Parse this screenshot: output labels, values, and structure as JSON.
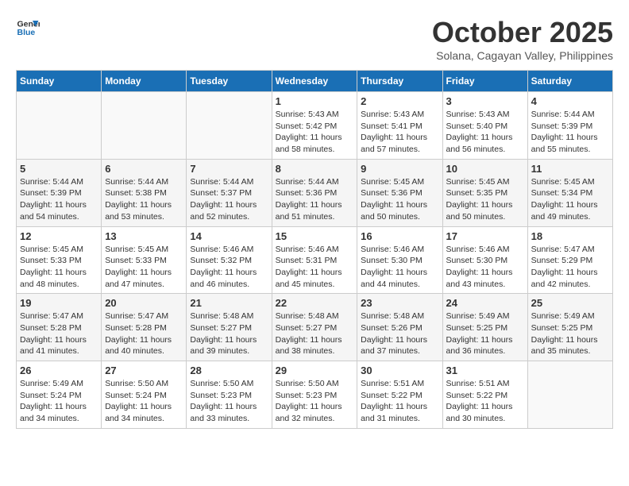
{
  "header": {
    "logo_line1": "General",
    "logo_line2": "Blue",
    "month": "October 2025",
    "location": "Solana, Cagayan Valley, Philippines"
  },
  "weekdays": [
    "Sunday",
    "Monday",
    "Tuesday",
    "Wednesday",
    "Thursday",
    "Friday",
    "Saturday"
  ],
  "weeks": [
    [
      {
        "day": "",
        "sunrise": "",
        "sunset": "",
        "daylight": ""
      },
      {
        "day": "",
        "sunrise": "",
        "sunset": "",
        "daylight": ""
      },
      {
        "day": "",
        "sunrise": "",
        "sunset": "",
        "daylight": ""
      },
      {
        "day": "1",
        "sunrise": "Sunrise: 5:43 AM",
        "sunset": "Sunset: 5:42 PM",
        "daylight": "Daylight: 11 hours and 58 minutes."
      },
      {
        "day": "2",
        "sunrise": "Sunrise: 5:43 AM",
        "sunset": "Sunset: 5:41 PM",
        "daylight": "Daylight: 11 hours and 57 minutes."
      },
      {
        "day": "3",
        "sunrise": "Sunrise: 5:43 AM",
        "sunset": "Sunset: 5:40 PM",
        "daylight": "Daylight: 11 hours and 56 minutes."
      },
      {
        "day": "4",
        "sunrise": "Sunrise: 5:44 AM",
        "sunset": "Sunset: 5:39 PM",
        "daylight": "Daylight: 11 hours and 55 minutes."
      }
    ],
    [
      {
        "day": "5",
        "sunrise": "Sunrise: 5:44 AM",
        "sunset": "Sunset: 5:39 PM",
        "daylight": "Daylight: 11 hours and 54 minutes."
      },
      {
        "day": "6",
        "sunrise": "Sunrise: 5:44 AM",
        "sunset": "Sunset: 5:38 PM",
        "daylight": "Daylight: 11 hours and 53 minutes."
      },
      {
        "day": "7",
        "sunrise": "Sunrise: 5:44 AM",
        "sunset": "Sunset: 5:37 PM",
        "daylight": "Daylight: 11 hours and 52 minutes."
      },
      {
        "day": "8",
        "sunrise": "Sunrise: 5:44 AM",
        "sunset": "Sunset: 5:36 PM",
        "daylight": "Daylight: 11 hours and 51 minutes."
      },
      {
        "day": "9",
        "sunrise": "Sunrise: 5:45 AM",
        "sunset": "Sunset: 5:36 PM",
        "daylight": "Daylight: 11 hours and 50 minutes."
      },
      {
        "day": "10",
        "sunrise": "Sunrise: 5:45 AM",
        "sunset": "Sunset: 5:35 PM",
        "daylight": "Daylight: 11 hours and 50 minutes."
      },
      {
        "day": "11",
        "sunrise": "Sunrise: 5:45 AM",
        "sunset": "Sunset: 5:34 PM",
        "daylight": "Daylight: 11 hours and 49 minutes."
      }
    ],
    [
      {
        "day": "12",
        "sunrise": "Sunrise: 5:45 AM",
        "sunset": "Sunset: 5:33 PM",
        "daylight": "Daylight: 11 hours and 48 minutes."
      },
      {
        "day": "13",
        "sunrise": "Sunrise: 5:45 AM",
        "sunset": "Sunset: 5:33 PM",
        "daylight": "Daylight: 11 hours and 47 minutes."
      },
      {
        "day": "14",
        "sunrise": "Sunrise: 5:46 AM",
        "sunset": "Sunset: 5:32 PM",
        "daylight": "Daylight: 11 hours and 46 minutes."
      },
      {
        "day": "15",
        "sunrise": "Sunrise: 5:46 AM",
        "sunset": "Sunset: 5:31 PM",
        "daylight": "Daylight: 11 hours and 45 minutes."
      },
      {
        "day": "16",
        "sunrise": "Sunrise: 5:46 AM",
        "sunset": "Sunset: 5:30 PM",
        "daylight": "Daylight: 11 hours and 44 minutes."
      },
      {
        "day": "17",
        "sunrise": "Sunrise: 5:46 AM",
        "sunset": "Sunset: 5:30 PM",
        "daylight": "Daylight: 11 hours and 43 minutes."
      },
      {
        "day": "18",
        "sunrise": "Sunrise: 5:47 AM",
        "sunset": "Sunset: 5:29 PM",
        "daylight": "Daylight: 11 hours and 42 minutes."
      }
    ],
    [
      {
        "day": "19",
        "sunrise": "Sunrise: 5:47 AM",
        "sunset": "Sunset: 5:28 PM",
        "daylight": "Daylight: 11 hours and 41 minutes."
      },
      {
        "day": "20",
        "sunrise": "Sunrise: 5:47 AM",
        "sunset": "Sunset: 5:28 PM",
        "daylight": "Daylight: 11 hours and 40 minutes."
      },
      {
        "day": "21",
        "sunrise": "Sunrise: 5:48 AM",
        "sunset": "Sunset: 5:27 PM",
        "daylight": "Daylight: 11 hours and 39 minutes."
      },
      {
        "day": "22",
        "sunrise": "Sunrise: 5:48 AM",
        "sunset": "Sunset: 5:27 PM",
        "daylight": "Daylight: 11 hours and 38 minutes."
      },
      {
        "day": "23",
        "sunrise": "Sunrise: 5:48 AM",
        "sunset": "Sunset: 5:26 PM",
        "daylight": "Daylight: 11 hours and 37 minutes."
      },
      {
        "day": "24",
        "sunrise": "Sunrise: 5:49 AM",
        "sunset": "Sunset: 5:25 PM",
        "daylight": "Daylight: 11 hours and 36 minutes."
      },
      {
        "day": "25",
        "sunrise": "Sunrise: 5:49 AM",
        "sunset": "Sunset: 5:25 PM",
        "daylight": "Daylight: 11 hours and 35 minutes."
      }
    ],
    [
      {
        "day": "26",
        "sunrise": "Sunrise: 5:49 AM",
        "sunset": "Sunset: 5:24 PM",
        "daylight": "Daylight: 11 hours and 34 minutes."
      },
      {
        "day": "27",
        "sunrise": "Sunrise: 5:50 AM",
        "sunset": "Sunset: 5:24 PM",
        "daylight": "Daylight: 11 hours and 34 minutes."
      },
      {
        "day": "28",
        "sunrise": "Sunrise: 5:50 AM",
        "sunset": "Sunset: 5:23 PM",
        "daylight": "Daylight: 11 hours and 33 minutes."
      },
      {
        "day": "29",
        "sunrise": "Sunrise: 5:50 AM",
        "sunset": "Sunset: 5:23 PM",
        "daylight": "Daylight: 11 hours and 32 minutes."
      },
      {
        "day": "30",
        "sunrise": "Sunrise: 5:51 AM",
        "sunset": "Sunset: 5:22 PM",
        "daylight": "Daylight: 11 hours and 31 minutes."
      },
      {
        "day": "31",
        "sunrise": "Sunrise: 5:51 AM",
        "sunset": "Sunset: 5:22 PM",
        "daylight": "Daylight: 11 hours and 30 minutes."
      },
      {
        "day": "",
        "sunrise": "",
        "sunset": "",
        "daylight": ""
      }
    ]
  ]
}
